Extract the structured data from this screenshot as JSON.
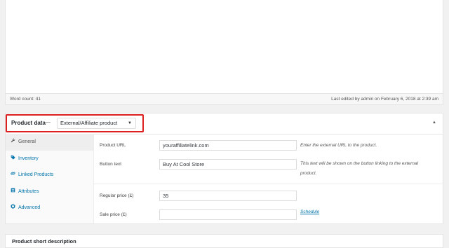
{
  "editor": {
    "word_count": "Word count: 41",
    "last_edited": "Last edited by admin on February 6, 2018 at 2:39 am"
  },
  "product_data": {
    "title": "Product data",
    "separator": "—",
    "product_type": "External/Affiliate product",
    "highlight_color": "#dd1f1f",
    "tabs": [
      {
        "label": "General",
        "icon": "wrench-icon"
      },
      {
        "label": "Inventory",
        "icon": "tag-icon"
      },
      {
        "label": "Linked Products",
        "icon": "link-icon"
      },
      {
        "label": "Attributes",
        "icon": "list-icon"
      },
      {
        "label": "Advanced",
        "icon": "gear-icon"
      }
    ],
    "fields": {
      "product_url": {
        "label": "Product URL",
        "value": "youraffiliatelink.com",
        "help": "Enter the external URL to the product."
      },
      "button_text": {
        "label": "Button text",
        "value": "Buy At Cool Store",
        "help": "This text will be shown on the button linking to the external product."
      },
      "regular_price": {
        "label": "Regular price (£)",
        "value": "35"
      },
      "sale_price": {
        "label": "Sale price (£)",
        "value": "",
        "schedule_link": "Schedule"
      }
    }
  },
  "short_description": {
    "title": "Product short description"
  }
}
